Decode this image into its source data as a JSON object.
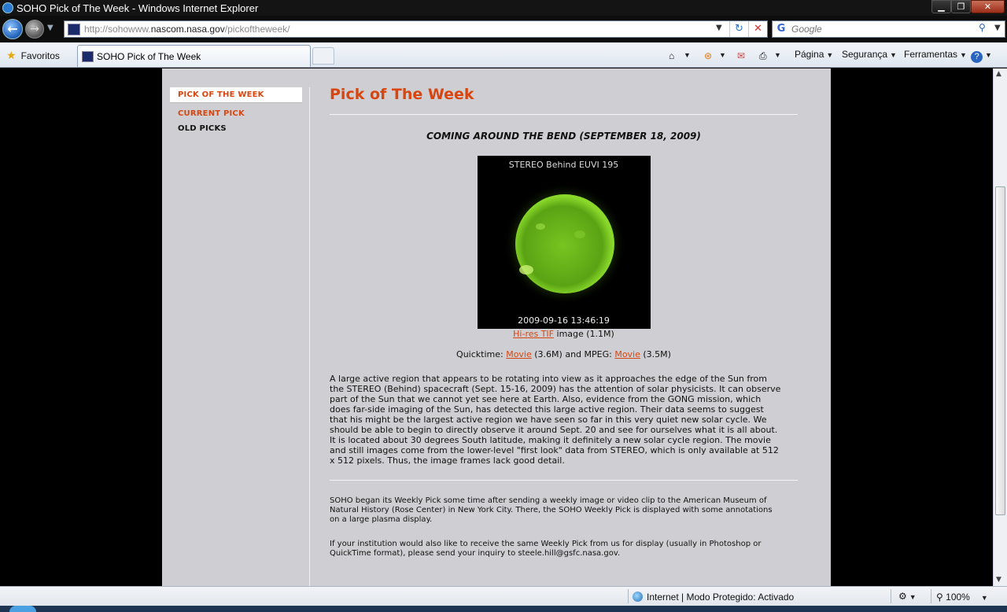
{
  "window": {
    "title": "SOHO Pick of The Week - Windows Internet Explorer",
    "min_label": "▁",
    "max_label": "❐",
    "close_label": "✕"
  },
  "navbar": {
    "url_prefix": "http://sohowww.",
    "url_domain": "nascom.nasa.gov",
    "url_path": "/pickoftheweek/",
    "search_placeholder": "Google"
  },
  "cmdbar": {
    "favorites_label": "Favoritos",
    "tab_label": "SOHO Pick of The Week",
    "page_label": "Página",
    "security_label": "Segurança",
    "tools_label": "Ferramentas"
  },
  "sidebar": {
    "items": [
      {
        "label": "PICK OF THE WEEK"
      },
      {
        "label": "CURRENT PICK"
      },
      {
        "label": "OLD PICKS"
      }
    ]
  },
  "article": {
    "heading": "Pick of The Week",
    "subtitle": "COMING AROUND THE BEND (SEPTEMBER 18, 2009)",
    "image_caption_top": "STEREO Behind EUVI 195",
    "image_caption_bottom": "2009-09-16 13:46:19",
    "hires_link": "Hi-res TIF",
    "hires_suffix": " image (1.1M)",
    "qt_prefix": "Quicktime: ",
    "qt_link": "Movie",
    "qt_mid": " (3.6M) and MPEG: ",
    "mpeg_link": "Movie",
    "mpeg_suffix": " (3.5M)",
    "body": "A large active region that appears to be rotating into view as it approaches the edge of the Sun from the STEREO (Behind) spacecraft (Sept. 15-16, 2009) has the attention of solar physicists. It can observe part of the Sun that we cannot yet see here at Earth. Also, evidence from the GONG mission, which does far-side imaging of the Sun, has detected this large active region. Their data seems to suggest that his might be the largest active region we have seen so far in this very quiet new solar cycle. We should be able to begin to directly observe it around Sept. 20 and see for ourselves what it is all about. It is located about 30 degrees South latitude, making it definitely a new solar cycle region. The movie and still images come from the lower-level \"first look\" data from STEREO, which is only available at 512 x 512 pixels. Thus, the image frames lack good detail.",
    "footer1": "SOHO began its Weekly Pick some time after sending a weekly image or video clip to the American Museum of Natural History (Rose Center) in New York City. There, the SOHO Weekly Pick is displayed with some annotations on a large plasma display.",
    "footer2": "If your institution would also like to receive the same Weekly Pick from us for display (usually in Photoshop or QuickTime format), please send your inquiry to steele.hill@gsfc.nasa.gov."
  },
  "statusbar": {
    "zone": "Internet | Modo Protegido: Activado",
    "zoom": "100%"
  },
  "colors": {
    "accent": "#d8450f",
    "page_bg": "#cfcfd3",
    "sun": "#6fbf1a"
  }
}
